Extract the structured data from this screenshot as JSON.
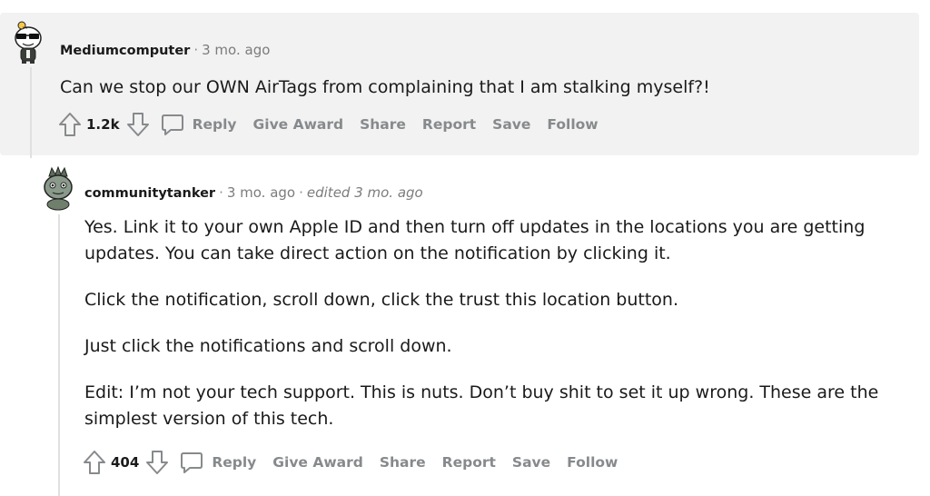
{
  "comments": [
    {
      "author": "Mediumcomputer",
      "time": "3 mo. ago",
      "edited": "",
      "paragraphs": [
        "Can we stop our OWN AirTags from complaining that I am stalking myself?!"
      ],
      "score": "1.2k",
      "avatar_icon": "snoo-avatar-sunglasses-icon"
    },
    {
      "author": "communitytanker",
      "time": "3 mo. ago",
      "edited": "edited 3 mo. ago",
      "paragraphs": [
        "Yes. Link it to your own Apple ID and then turn off updates in the locations you are getting updates. You can take direct action on the notification by clicking it.",
        "Click the notification, scroll down, click the trust this location button.",
        "Just click the notifications and scroll down.",
        "Edit: I’m not your tech support. This is nuts. Don’t buy shit to set it up wrong. These are the simplest version of this tech."
      ],
      "score": "404",
      "avatar_icon": "snoo-avatar-crown-icon"
    }
  ],
  "actions": {
    "reply": "Reply",
    "give_award": "Give Award",
    "share": "Share",
    "report": "Report",
    "save": "Save",
    "follow": "Follow"
  },
  "meta_separator": "·",
  "colors": {
    "thread_background": "#f2f2f2",
    "meta_text": "#7c7c7c",
    "action_text": "#878a8c"
  }
}
